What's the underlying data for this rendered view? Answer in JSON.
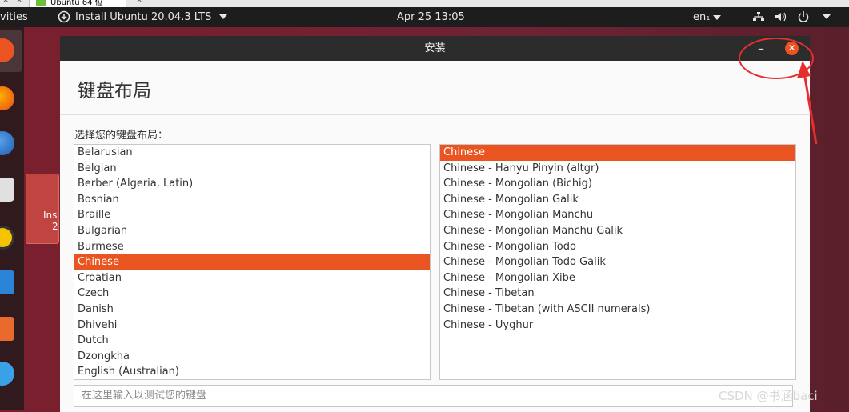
{
  "host_tab": {
    "label": "Ubuntu 64 位",
    "close": "×"
  },
  "topbar": {
    "activities": "vities",
    "installer_label": "Install Ubuntu 20.04.3 LTS",
    "clock": "Apr 25  13:05",
    "language": "en₁"
  },
  "dock_icon_label": {
    "line1": "Ins",
    "line2": "2"
  },
  "window": {
    "title": "安装",
    "heading": "键盘布局",
    "prompt": "选择您的键盘布局：",
    "layouts": [
      "Belarusian",
      "Belgian",
      "Berber (Algeria, Latin)",
      "Bosnian",
      "Braille",
      "Bulgarian",
      "Burmese",
      "Chinese",
      "Croatian",
      "Czech",
      "Danish",
      "Dhivehi",
      "Dutch",
      "Dzongkha",
      "English (Australian)"
    ],
    "selected_layout": "Chinese",
    "variants": [
      "Chinese",
      "Chinese - Hanyu Pinyin (altgr)",
      "Chinese - Mongolian (Bichig)",
      "Chinese - Mongolian Galik",
      "Chinese - Mongolian Manchu",
      "Chinese - Mongolian Manchu Galik",
      "Chinese - Mongolian Todo",
      "Chinese - Mongolian Todo Galik",
      "Chinese - Mongolian Xibe",
      "Chinese - Tibetan",
      "Chinese - Tibetan (with ASCII numerals)",
      "Chinese - Uyghur"
    ],
    "selected_variant": "Chinese",
    "test_placeholder": "在这里输入以测试您的键盘"
  },
  "watermark": "CSDN @书涵baci",
  "colors": {
    "accent": "#e95420",
    "annotation": "#e62e2e"
  }
}
